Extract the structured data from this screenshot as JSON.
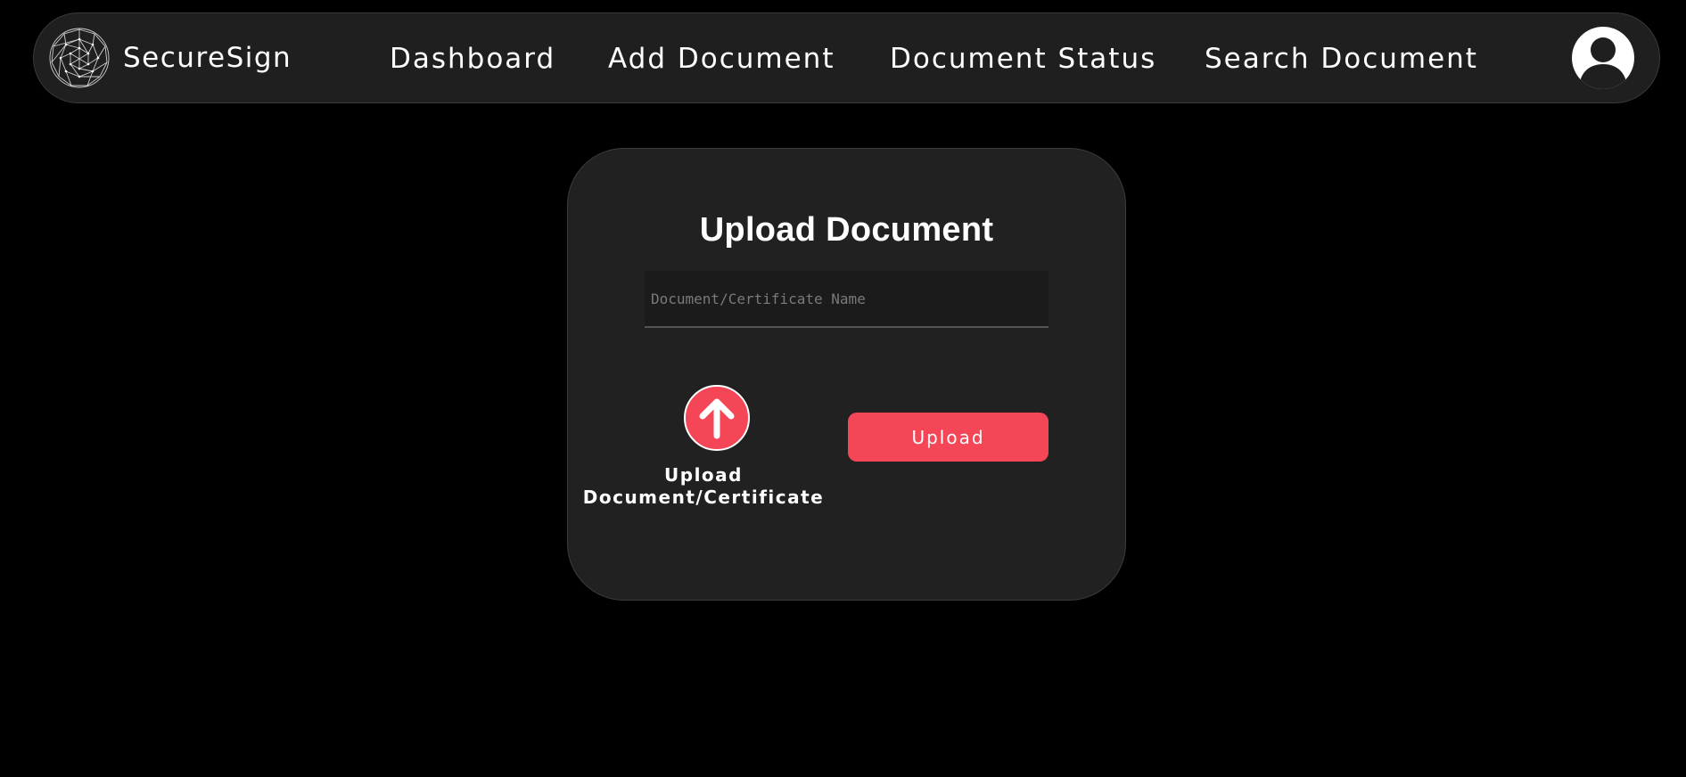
{
  "navbar": {
    "brand_name": "SecureSign",
    "brand_logo_icon": "wireframe-globe-icon",
    "links": {
      "dashboard": "Dashboard",
      "add_document": "Add Document",
      "document_status": "Document Status",
      "search_document": "Search Document"
    },
    "avatar_icon": "user-avatar-icon"
  },
  "upload_card": {
    "title": "Upload Document",
    "name_input": {
      "value": "",
      "placeholder": "Document/Certificate Name"
    },
    "file_picker": {
      "icon": "upload-arrow-icon",
      "label_line1": "Upload",
      "label_line2": "Document/Certificate"
    },
    "upload_button_label": "Upload"
  },
  "colors": {
    "background": "#000000",
    "panel": "#212121",
    "accent": "#f44656",
    "text": "#ffffff"
  }
}
